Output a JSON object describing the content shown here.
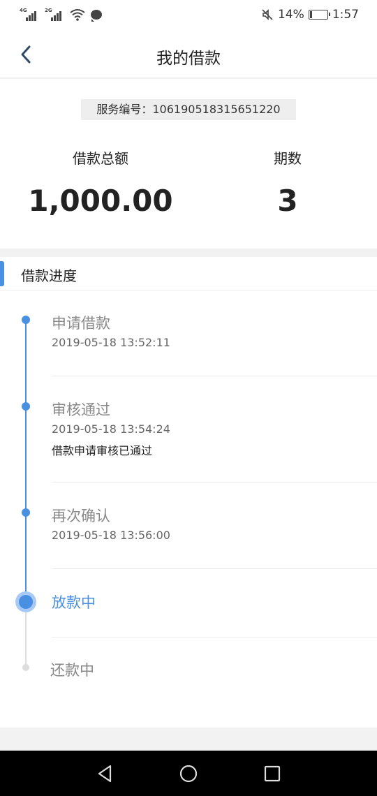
{
  "status_bar": {
    "network1": "4G",
    "network2": "2G",
    "battery_percent": "14%",
    "battery_level": 0.14,
    "time": "1:57"
  },
  "header": {
    "title": "我的借款"
  },
  "summary": {
    "service_number": "服务编号：106190518315651220",
    "loan_total_label": "借款总额",
    "loan_total_value": "1,000.00",
    "periods_label": "期数",
    "periods_value": "3"
  },
  "progress": {
    "section_title": "借款进度",
    "steps": [
      {
        "title": "申请借款",
        "time": "2019-05-18 13:52:11",
        "note": ""
      },
      {
        "title": "审核通过",
        "time": "2019-05-18 13:54:24",
        "note": "借款申请审核已通过"
      },
      {
        "title": "再次确认",
        "time": "2019-05-18 13:56:00",
        "note": ""
      },
      {
        "title": "放款中",
        "time": "",
        "note": ""
      },
      {
        "title": "还款中",
        "time": "",
        "note": ""
      }
    ],
    "current_step_index": 3
  },
  "colors": {
    "accent": "#4a90e2",
    "pending": "#dddddd",
    "background": "#f2f2f2"
  },
  "icons": {
    "back": "chevron-left-icon",
    "sys_back": "triangle-back-icon",
    "sys_home": "circle-home-icon",
    "sys_recent": "square-recent-icon"
  }
}
